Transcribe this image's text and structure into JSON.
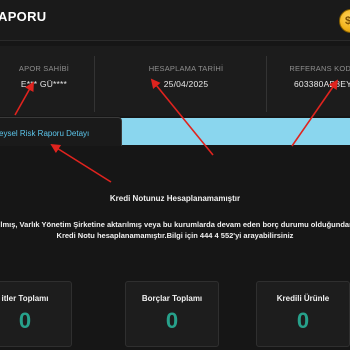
{
  "header": {
    "title": "APORU",
    "coin_icon": "coin-icon",
    "coin_letter": "$"
  },
  "info": {
    "owner_label": "APOR SAHİBİ",
    "owner_value": "E*** GÜ****",
    "date_label": "HESAPLAMA TARİHİ",
    "date_value": "25/04/2025",
    "ref_label": "REFERANS KODU",
    "ref_value": "603380AB8EY"
  },
  "tabs": {
    "active_label": "eysel Risk Raporu Detayı",
    "strip_color": "#8ad6ee",
    "active_text_color": "#5cc6ec"
  },
  "status": {
    "title": "Kredi Notunuz Hesaplanamamıştır",
    "line1": "ılmış, Varlık Yönetim Şirketine aktarılmış veya bu kurumlarda devam eden borç durumu olduğundan",
    "line2": "Kredi Notu hesaplanamamıştır.Bilgi için 444 4 552'yi arayabilirsiniz"
  },
  "summary": [
    {
      "label": "itler Toplamı",
      "value": "0"
    },
    {
      "label": "Borçlar Toplamı",
      "value": "0"
    },
    {
      "label": "Kredili Ürünle",
      "value": "0"
    }
  ],
  "annotation_color": "#e0231e",
  "accent_color": "#27a18b"
}
